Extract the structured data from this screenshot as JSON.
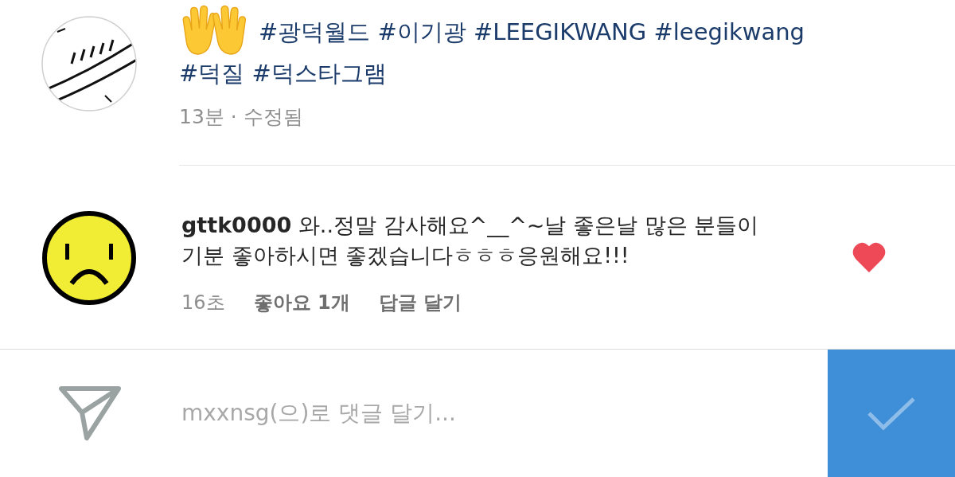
{
  "post": {
    "caption_lines": [
      "#광덕월드 #이기광 #LEEGIKWANG #leegikwang",
      "#덕질 #덕스타그램"
    ],
    "meta": "13분 · 수정됨"
  },
  "comment": {
    "username": "gttk0000",
    "text": "와..정말 감사해요^__^~날 좋은날 많은 분들이 기분 좋아하시면 좋겠습니다ㅎㅎㅎ응원해요!!!",
    "time": "16초",
    "likes": "좋아요 1개",
    "reply": "답글 달기",
    "liked": true
  },
  "composer": {
    "placeholder": "mxxnsg(으)로 댓글 달기..."
  }
}
